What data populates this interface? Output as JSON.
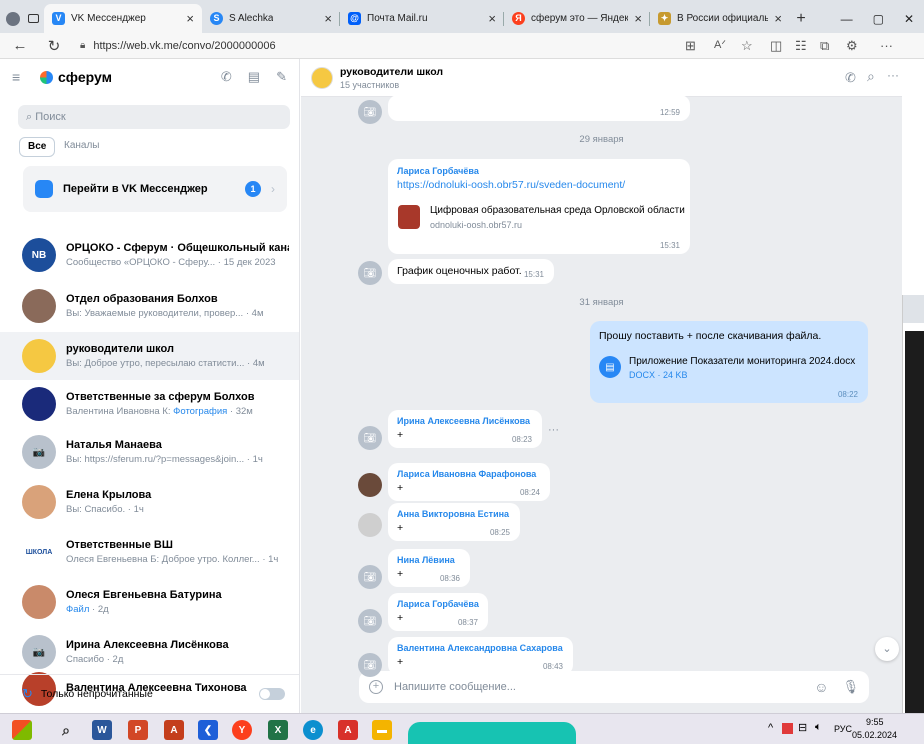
{
  "browser": {
    "tabs": [
      {
        "label": "VK Мессенджер",
        "color": "#2787f5",
        "glyph": "V"
      },
      {
        "label": "S Alechka",
        "color": "#2787f5",
        "glyph": "S"
      },
      {
        "label": "Почта Mail.ru",
        "color": "#005ff9",
        "glyph": "@"
      },
      {
        "label": "сферум это — Яндекс: н",
        "color": "#fc3f1d",
        "glyph": "Я"
      },
      {
        "label": "В России официально з",
        "color": "#c79a2f",
        "glyph": "✦"
      }
    ],
    "url": "https://web.vk.me/convo/2000000006"
  },
  "sidebar": {
    "brand": "сферум",
    "search_placeholder": "Поиск",
    "filters": [
      "Все",
      "Каналы"
    ],
    "promo": {
      "label": "Перейти в VK Мессенджер",
      "badge": "1"
    },
    "conversations": [
      {
        "name": "ОРЦОКО - Сферум · Общешкольный канал",
        "preview": "Сообщество «ОРЦОКО - Сферу...",
        "time": "15 дек 2023",
        "avatar_color": "#1c4e9b",
        "avatar_text": "NB"
      },
      {
        "name": "Отдел образования Болхов",
        "preview": "Вы: Уважаемые руководители, провер...",
        "time": "4м",
        "avatar_color": "#8a6a5a",
        "avatar_text": ""
      },
      {
        "name": "руководители школ",
        "preview": "Вы: Доброе утро, пересылаю статисти...",
        "time": "4м",
        "avatar_color": "#f5c842",
        "avatar_text": ""
      },
      {
        "name": "Ответственные за сферум Болхов",
        "preview_prefix": "Валентина Ивановна К:",
        "preview": "Фотография",
        "time": "32м",
        "avatar_color": "#1a2a7a",
        "avatar_text": ""
      },
      {
        "name": "Наталья Манаева",
        "preview": "Вы: https://sferum.ru/?p=messages&join...",
        "time": "1ч",
        "avatar_color": "#b8c1cc",
        "avatar_text": "📷"
      },
      {
        "name": "Елена Крылова",
        "preview": "Вы: Спасибо.",
        "time": "1ч",
        "avatar_color": "#d9a27a",
        "avatar_text": ""
      },
      {
        "name": "Ответственные ВШ",
        "preview": "Олеся Евгеньевна Б: Доброе утро. Коллег...",
        "time": "1ч",
        "avatar_color": "#ffffff",
        "avatar_text": "ШКОЛА"
      },
      {
        "name": "Олеся Евгеньевна Батурина",
        "preview_hl": "Файл",
        "preview": "",
        "time": "2д",
        "avatar_color": "#c98a6a",
        "avatar_text": ""
      },
      {
        "name": "Ирина Алексеевна Лисёнкова",
        "preview": "Спасибо",
        "time": "2д",
        "avatar_color": "#b8c1cc",
        "avatar_text": "📷"
      },
      {
        "name": "Валентина Алексеевна Тихонова",
        "preview": "",
        "time": "",
        "avatar_color": "#b8402a",
        "avatar_text": ""
      }
    ],
    "unread_label": "Только непрочитанные"
  },
  "chat": {
    "title": "руководители школ",
    "subtitle": "15 участников",
    "messages": [
      {
        "kind": "time_only",
        "time": "12:59"
      },
      {
        "kind": "date",
        "text": "29 января"
      },
      {
        "kind": "link",
        "sender": "Лариса Горбачёва",
        "link": "https://odnoluki-oosh.obr57.ru/sveden-document/",
        "preview_title": "Цифровая образовательная среда Орловской области",
        "preview_domain": "odnoluki-oosh.obr57.ru",
        "time": "15:31"
      },
      {
        "kind": "text",
        "text": "График оценочных работ.",
        "time": "15:31"
      },
      {
        "kind": "date",
        "text": "31 января"
      },
      {
        "kind": "outgoing",
        "text": "Прошу поставить + после скачивания файла.",
        "file_name": "Приложение Показатели мониторинга 2024.docx",
        "file_meta": "DOCX · 24 KB",
        "time": "08:22"
      },
      {
        "sender": "Ирина Алексеевна Лисёнкова",
        "text": "+",
        "time": "08:23"
      },
      {
        "sender": "Лариса Ивановна Фарафонова",
        "text": "+",
        "time": "08:24"
      },
      {
        "sender": "Анна Викторовна Естина",
        "text": "+",
        "time": "08:25"
      },
      {
        "sender": "Нина Лёвина",
        "text": "+",
        "time": "08:36"
      },
      {
        "sender": "Лариса Горбачёва",
        "text": "+",
        "time": "08:37"
      },
      {
        "sender": "Валентина Александровна Сахарова",
        "text": "+",
        "time": "08:43"
      }
    ],
    "composer_placeholder": "Напишите сообщение..."
  },
  "taskbar": {
    "lang": "РУС",
    "time": "9:55",
    "date": "05.02.2024"
  }
}
